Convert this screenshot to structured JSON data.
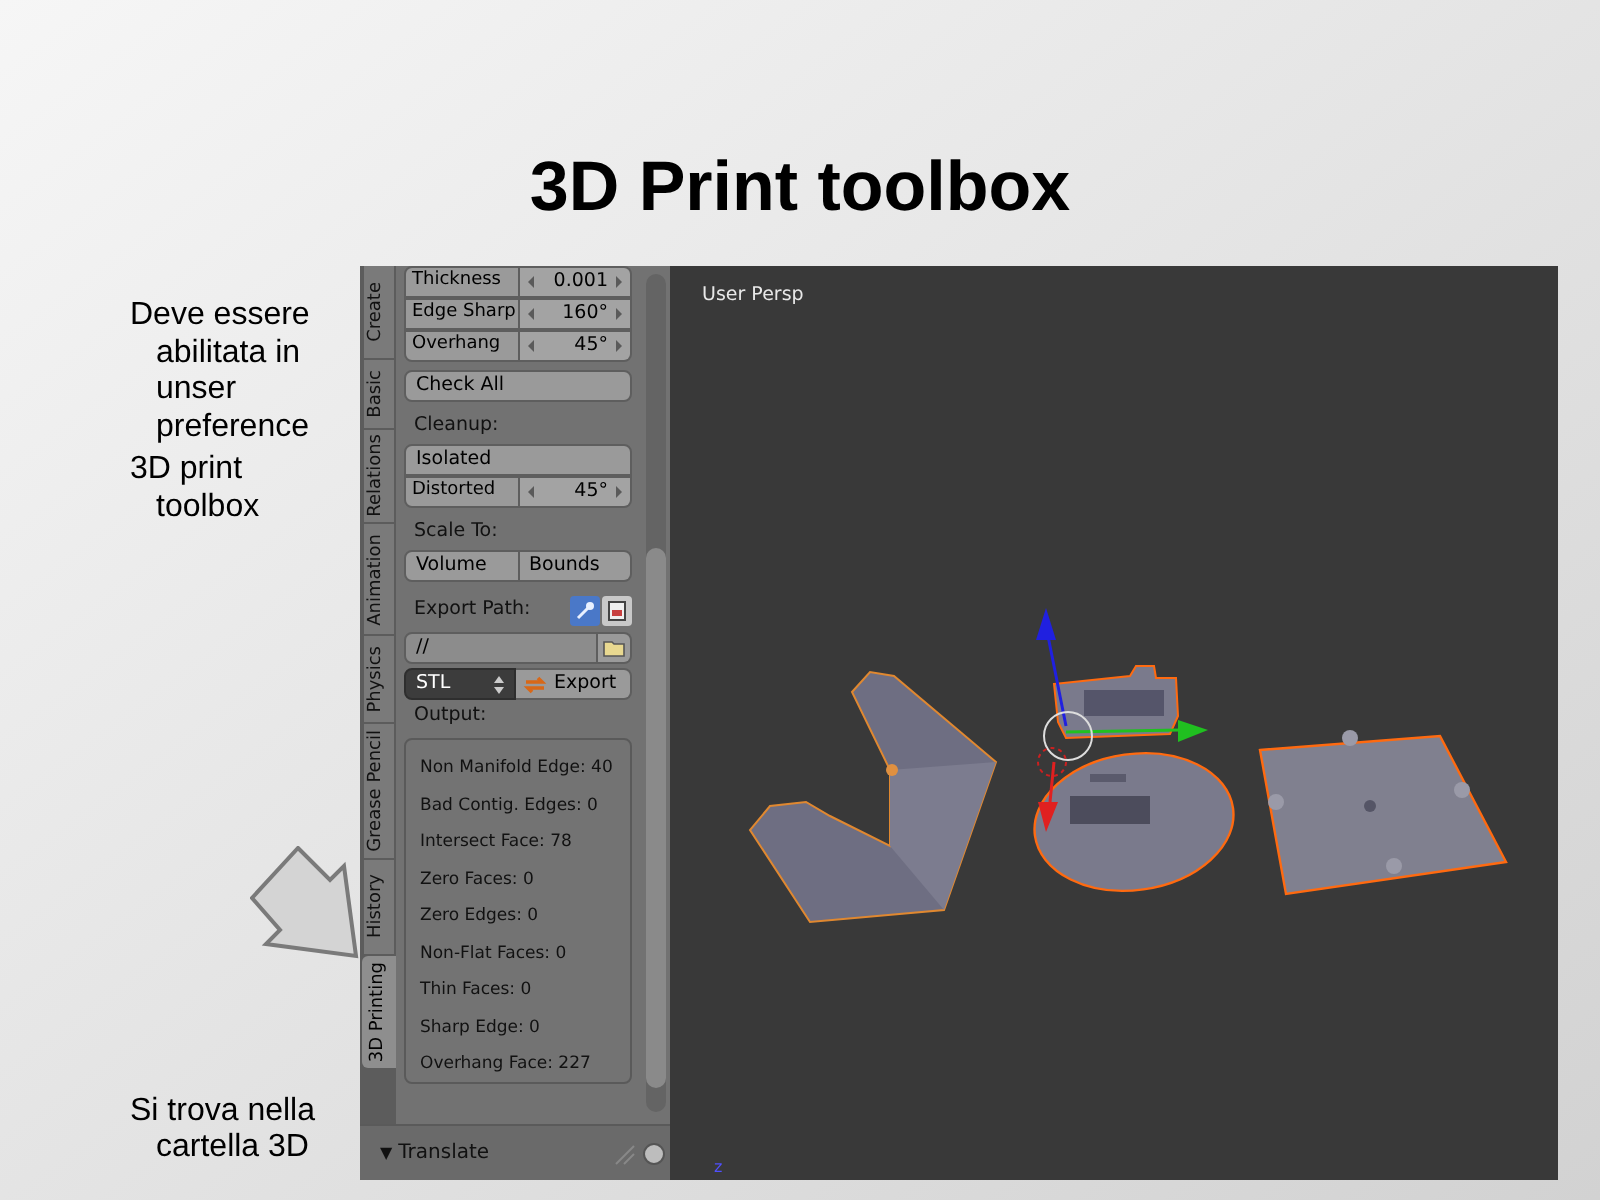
{
  "slide": {
    "title": "3D Print toolbox",
    "bullets": [
      {
        "text": "Deve essere abilitata in unser preference"
      },
      {
        "text": "3D print toolbox"
      }
    ],
    "note": "Si trova nella cartella 3D"
  },
  "toolshelf": {
    "tabs": [
      {
        "label": "Create",
        "selected": false
      },
      {
        "label": "Basic",
        "selected": false
      },
      {
        "label": "Relations",
        "selected": false
      },
      {
        "label": "Animation",
        "selected": false
      },
      {
        "label": "Physics",
        "selected": false
      },
      {
        "label": "Grease Pencil",
        "selected": false
      },
      {
        "label": "History",
        "selected": false
      },
      {
        "label": "3D Printing",
        "selected": true
      }
    ],
    "rows": [
      {
        "kind": "group",
        "items": [
          {
            "kind": "field",
            "label": "Thickness",
            "value": "0.001"
          },
          {
            "kind": "field",
            "label": "Edge Sharp",
            "value": "160°"
          },
          {
            "kind": "field",
            "label": "Overhang",
            "value": "45°"
          }
        ]
      },
      {
        "kind": "button",
        "label": "Check All"
      },
      {
        "kind": "heading",
        "label": "Cleanup:"
      },
      {
        "kind": "group",
        "items": [
          {
            "kind": "button",
            "label": "Isolated"
          },
          {
            "kind": "field",
            "label": "Distorted",
            "value": "45°"
          }
        ]
      },
      {
        "kind": "heading",
        "label": "Scale To:"
      },
      {
        "kind": "pair",
        "labels": [
          "Volume",
          "Bounds"
        ]
      },
      {
        "kind": "path_heading",
        "label": "Export Path:"
      },
      {
        "kind": "path",
        "value": "//"
      },
      {
        "kind": "export",
        "format": "STL",
        "label": "Export"
      },
      {
        "kind": "heading",
        "label": "Output:"
      }
    ],
    "output": [
      "Non Manifold Edge: 40",
      "Bad Contig. Edges: 0",
      "Intersect Face: 78",
      "Zero Faces: 0",
      "Zero Edges: 0",
      "Non-Flat Faces: 0",
      "Thin Faces: 0",
      "Sharp Edge: 0",
      "Overhang Face: 227"
    ],
    "footer": {
      "toggle": "▼",
      "label": "Translate"
    }
  },
  "viewport": {
    "label": "User Persp",
    "axis_label": "z"
  }
}
